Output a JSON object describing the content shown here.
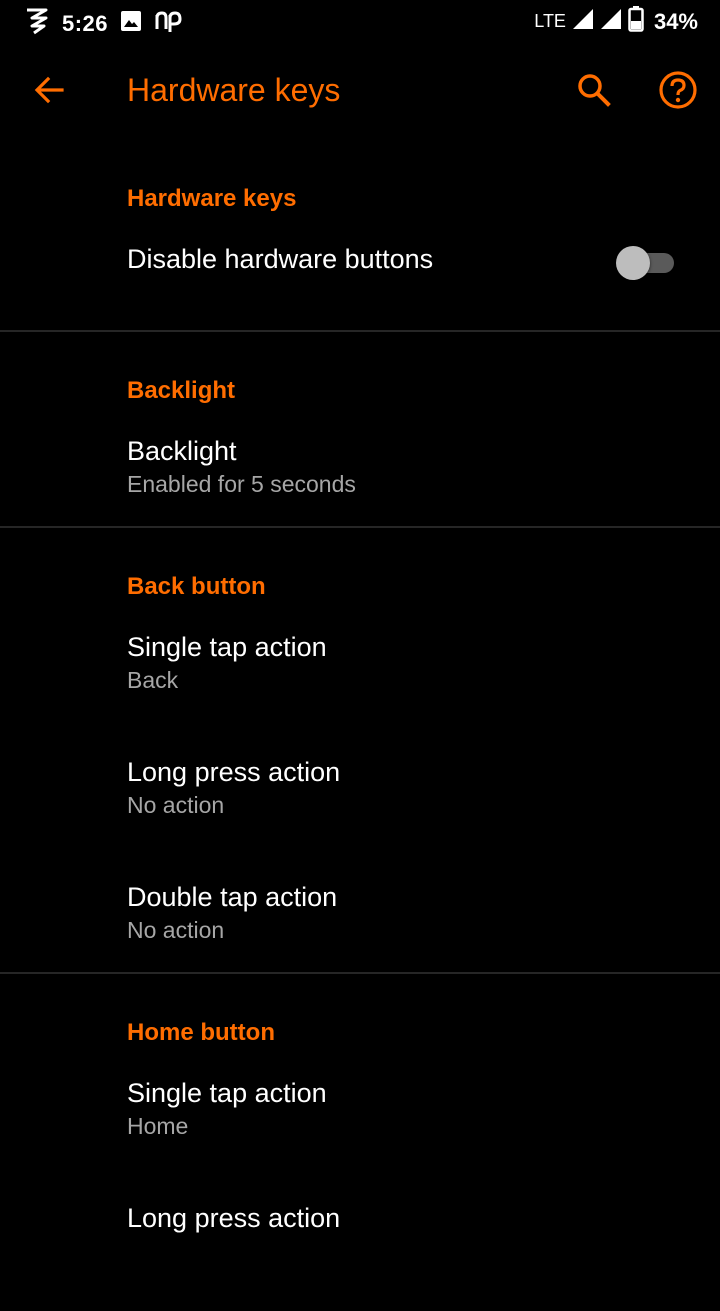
{
  "status_bar": {
    "time": "5:26",
    "network": "LTE",
    "battery": "34%",
    "icons": [
      "app-notification-icon",
      "image-icon",
      "np-icon",
      "signal-icon",
      "signal-icon",
      "battery-icon"
    ]
  },
  "app_bar": {
    "title": "Hardware keys",
    "icons": [
      "back-arrow-icon",
      "search-icon",
      "help-icon"
    ]
  },
  "colors": {
    "accent": "#ff6d00",
    "background": "#000000",
    "divider": "#262626",
    "summary": "#a6a6a6"
  },
  "sections": [
    {
      "header": "Hardware keys",
      "items": [
        {
          "title": "Disable hardware buttons",
          "toggle": false
        }
      ]
    },
    {
      "header": "Backlight",
      "items": [
        {
          "title": "Backlight",
          "summary": "Enabled for 5 seconds"
        }
      ]
    },
    {
      "header": "Back button",
      "items": [
        {
          "title": "Single tap action",
          "summary": "Back"
        },
        {
          "title": "Long press action",
          "summary": "No action"
        },
        {
          "title": "Double tap action",
          "summary": "No action"
        }
      ]
    },
    {
      "header": "Home button",
      "items": [
        {
          "title": "Single tap action",
          "summary": "Home"
        },
        {
          "title": "Long press action"
        }
      ]
    }
  ]
}
